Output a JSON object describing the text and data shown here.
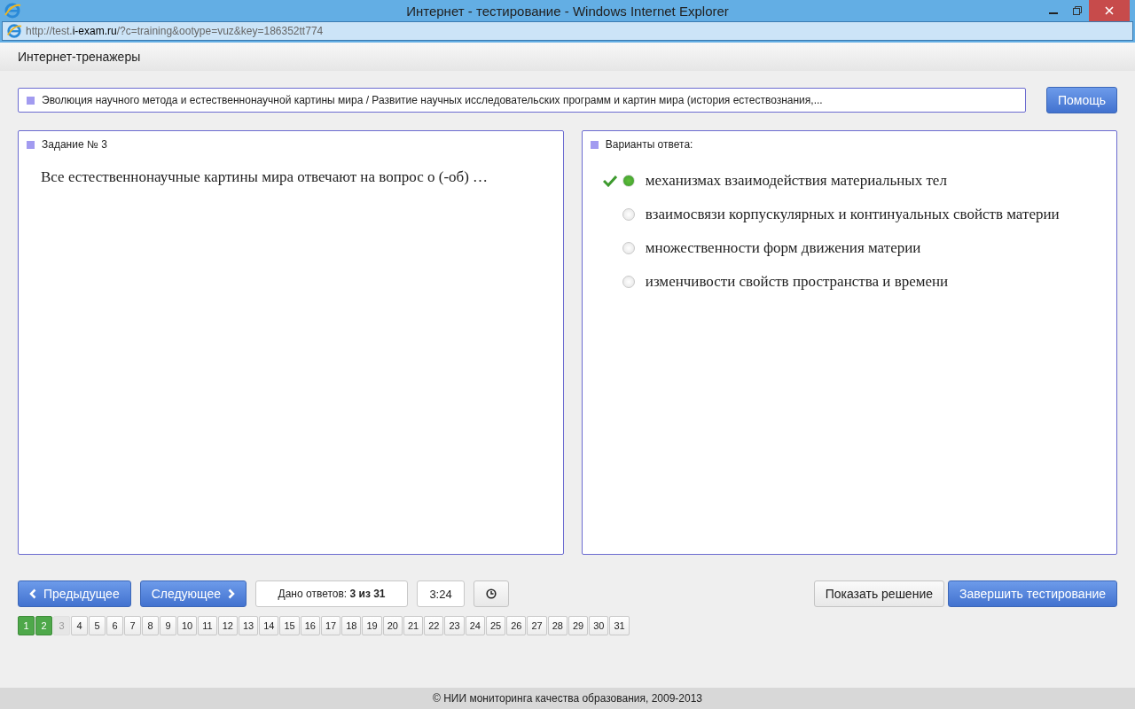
{
  "window": {
    "title": "Интернет - тестирование - Windows Internet Explorer"
  },
  "address_bar": {
    "url_prefix": "http://test.",
    "url_domain": "i-exam.ru",
    "url_rest": "/?c=training&ootype=vuz&key=186352tt774"
  },
  "header": {
    "title": "Интернет-тренажеры"
  },
  "topic": {
    "text": "Эволюция научного метода и естественнонаучной картины мира / Развитие научных исследовательских программ и картин мира (история естествознания,..."
  },
  "help_button": "Помощь",
  "task": {
    "title": "Задание № 3",
    "question": "Все естественнонаучные картины мира отвечают на вопрос о (-об) …"
  },
  "answers": {
    "title": "Варианты ответа:",
    "options": [
      {
        "text": "механизмах взаимодействия материальных тел",
        "selected": true,
        "marked": true
      },
      {
        "text": "взаимосвязи корпускулярных и континуальных свойств материи",
        "selected": false,
        "marked": false
      },
      {
        "text": "множественности форм движения материи",
        "selected": false,
        "marked": false
      },
      {
        "text": "изменчивости свойств пространства и времени",
        "selected": false,
        "marked": false
      }
    ]
  },
  "nav": {
    "prev": "Предыдущее",
    "next": "Следующее",
    "answered_count": "Дано ответов: **3 из 31**",
    "timer": "3:24",
    "show_solution": "Показать решение",
    "finish": "Завершить тестирование"
  },
  "pages": [
    {
      "label": "1",
      "answered": true,
      "selected": false
    },
    {
      "label": "2",
      "answered": true,
      "selected": false
    },
    {
      "label": "3",
      "answered": false,
      "selected": true
    },
    {
      "label": "4",
      "answered": false,
      "selected": false
    },
    {
      "label": "5",
      "answered": false,
      "selected": false
    },
    {
      "label": "6",
      "answered": false,
      "selected": false
    },
    {
      "label": "7",
      "answered": false,
      "selected": false
    },
    {
      "label": "8",
      "answered": false,
      "selected": false
    },
    {
      "label": "9",
      "answered": false,
      "selected": false
    },
    {
      "label": "10",
      "answered": false,
      "selected": false
    },
    {
      "label": "11",
      "answered": false,
      "selected": false
    },
    {
      "label": "12",
      "answered": false,
      "selected": false
    },
    {
      "label": "13",
      "answered": false,
      "selected": false
    },
    {
      "label": "14",
      "answered": false,
      "selected": false
    },
    {
      "label": "15",
      "answered": false,
      "selected": false
    },
    {
      "label": "16",
      "answered": false,
      "selected": false
    },
    {
      "label": "17",
      "answered": false,
      "selected": false
    },
    {
      "label": "18",
      "answered": false,
      "selected": false
    },
    {
      "label": "19",
      "answered": false,
      "selected": false
    },
    {
      "label": "20",
      "answered": false,
      "selected": false
    },
    {
      "label": "21",
      "answered": false,
      "selected": false
    },
    {
      "label": "22",
      "answered": false,
      "selected": false
    },
    {
      "label": "23",
      "answered": false,
      "selected": false
    },
    {
      "label": "24",
      "answered": false,
      "selected": false
    },
    {
      "label": "25",
      "answered": false,
      "selected": false
    },
    {
      "label": "26",
      "answered": false,
      "selected": false
    },
    {
      "label": "27",
      "answered": false,
      "selected": false
    },
    {
      "label": "28",
      "answered": false,
      "selected": false
    },
    {
      "label": "29",
      "answered": false,
      "selected": false
    },
    {
      "label": "30",
      "answered": false,
      "selected": false
    },
    {
      "label": "31",
      "answered": false,
      "selected": false
    }
  ],
  "footer": "© НИИ мониторинга качества образования, 2009-2013"
}
